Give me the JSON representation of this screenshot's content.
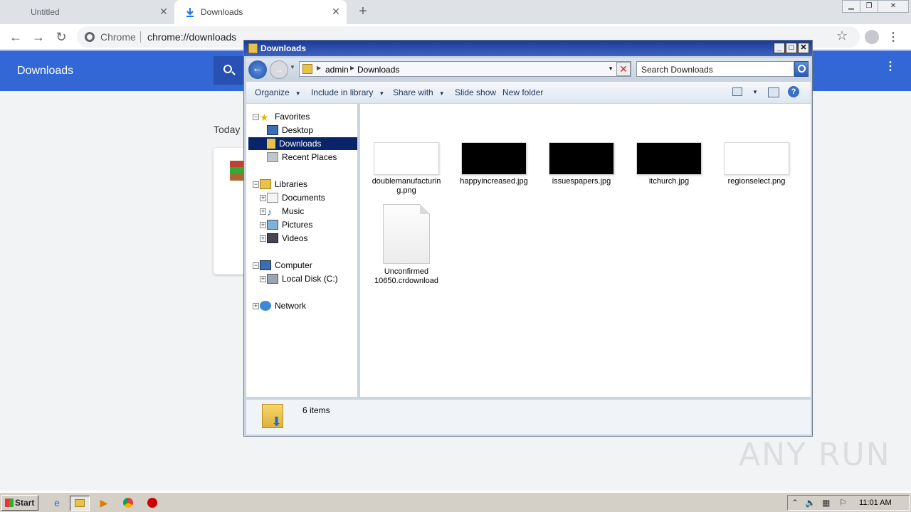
{
  "chrome": {
    "tabs": [
      {
        "label": "Untitled"
      },
      {
        "label": "Downloads"
      }
    ],
    "omnibox": {
      "site_label": "Chrome",
      "url": "chrome://downloads"
    },
    "page": {
      "title": "Downloads",
      "section": "Today"
    }
  },
  "explorer": {
    "title": "Downloads",
    "breadcrumb": [
      "admin",
      "Downloads"
    ],
    "search_placeholder": "Search Downloads",
    "commands": [
      "Organize",
      "Include in library",
      "Share with",
      "Slide show",
      "New folder"
    ],
    "nav": {
      "favorites": {
        "label": "Favorites",
        "items": [
          "Desktop",
          "Downloads",
          "Recent Places"
        ]
      },
      "libraries": {
        "label": "Libraries",
        "items": [
          "Documents",
          "Music",
          "Pictures",
          "Videos"
        ]
      },
      "computer": {
        "label": "Computer",
        "items": [
          "Local Disk (C:)"
        ]
      },
      "network": {
        "label": "Network"
      }
    },
    "files": [
      {
        "name": "doublemanufacturin\ng.png",
        "thumb": "white"
      },
      {
        "name": "happyincreased.jpg",
        "thumb": "black"
      },
      {
        "name": "issuespapers.jpg",
        "thumb": "black"
      },
      {
        "name": "itchurch.jpg",
        "thumb": "black"
      },
      {
        "name": "regionselect.png",
        "thumb": "white"
      },
      {
        "name": "Unconfirmed\n10650.crdownload",
        "thumb": "doc"
      }
    ],
    "status": "6 items"
  },
  "taskbar": {
    "start_label": "Start",
    "clock": "11:01 AM"
  },
  "watermark": "ANY RUN",
  "colors": {
    "chrome_blue": "#3367d6",
    "nav_selected": "#0a246a"
  }
}
